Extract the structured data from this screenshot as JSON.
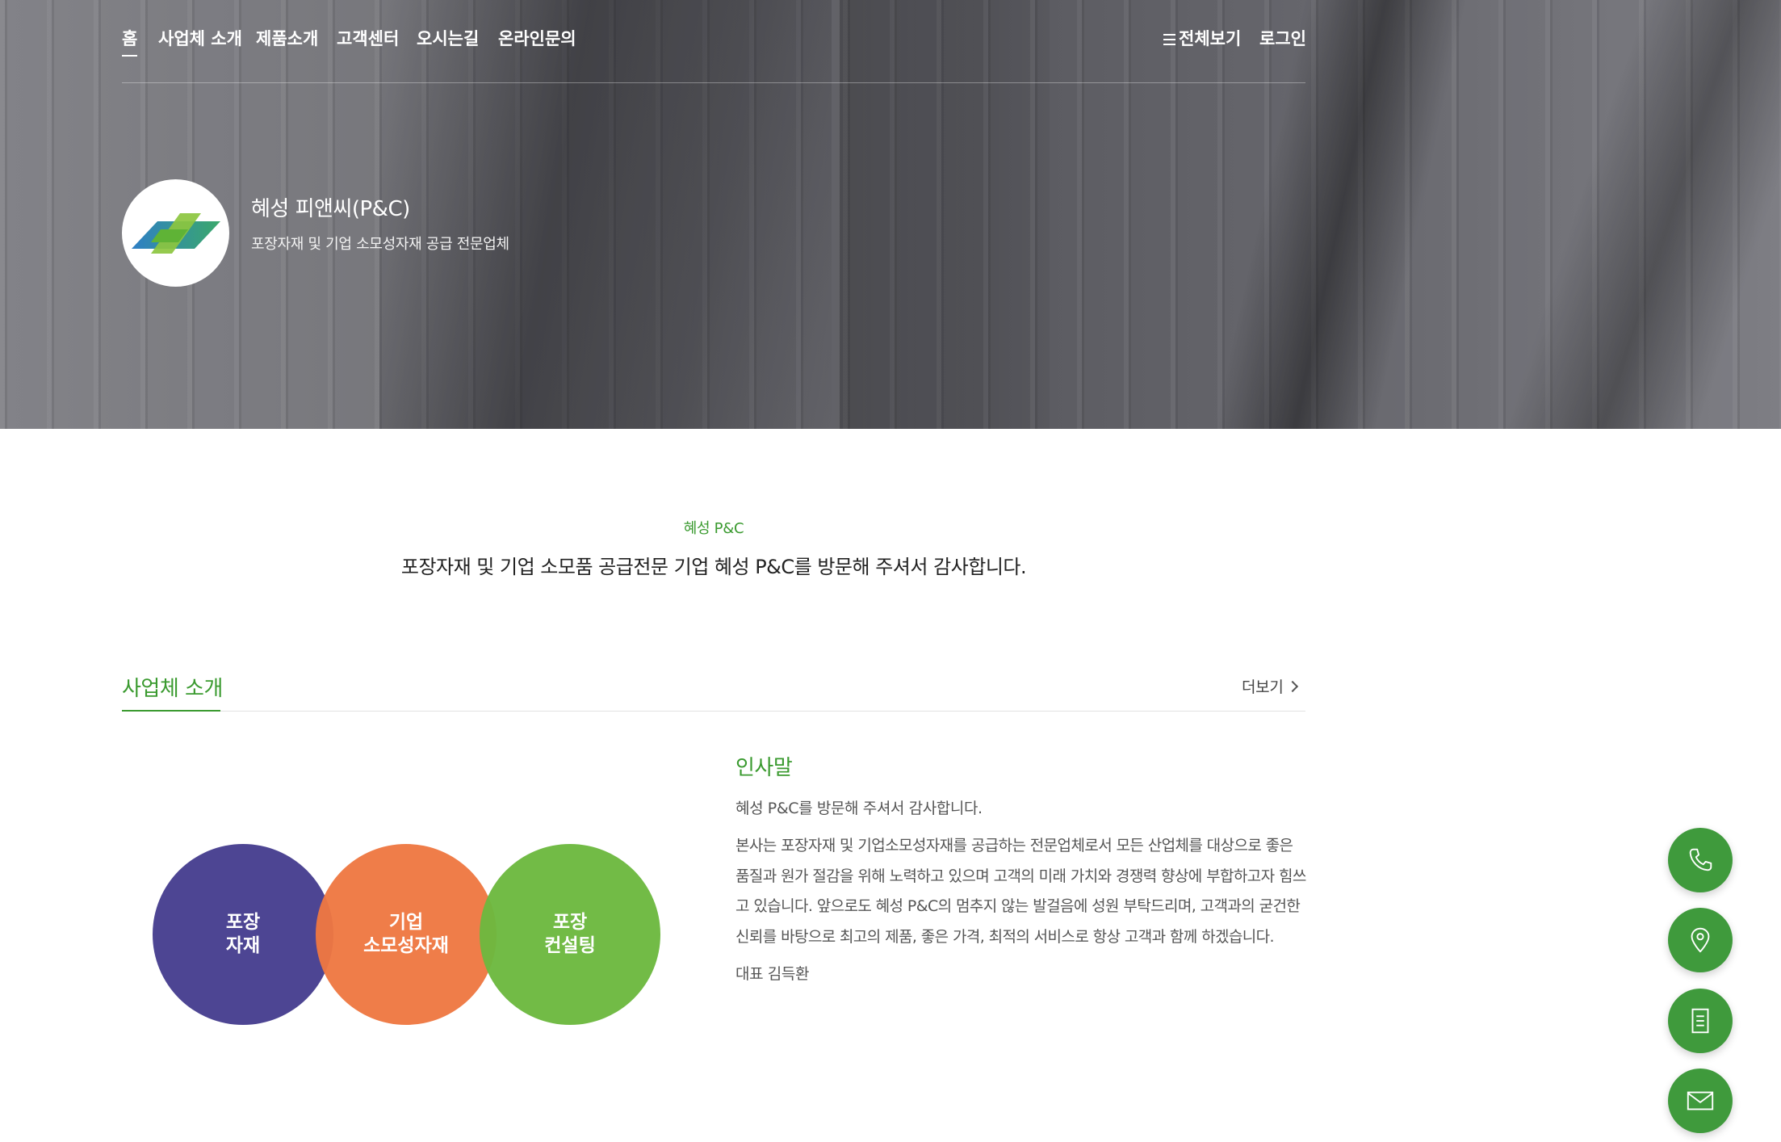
{
  "nav": {
    "items": [
      {
        "label": "홈",
        "active": true
      },
      {
        "label": "사업체 소개"
      },
      {
        "label": "제품소개"
      },
      {
        "label": "고객센터"
      },
      {
        "label": "오시는길"
      },
      {
        "label": "온라인문의"
      }
    ],
    "all_menu_label": "전체보기",
    "login_label": "로그인"
  },
  "company": {
    "name": "혜성 피앤씨(P&C)",
    "tagline": "포장자재 및 기업 소모성자재 공급 전문업체"
  },
  "welcome": {
    "label": "혜성 P&C",
    "text": "포장자재 및 기업 소모품 공급전문 기업 혜성 P&C를 방문해 주셔서 감사합니다."
  },
  "about": {
    "title": "사업체 소개",
    "more_label": "더보기",
    "venn": [
      {
        "label": "포장\n자재",
        "color": "#4d4593"
      },
      {
        "label": "기업\n소모성자재",
        "color": "#ee7842"
      },
      {
        "label": "포장\n컨설팅",
        "color": "#6cb83e"
      }
    ],
    "greeting": {
      "title": "인사말",
      "lead": "혜성 P&C를 방문해 주셔서 감사합니다.",
      "body": "본사는 포장자재 및 기업소모성자재를 공급하는 전문업체로서 모든 산업체를 대상으로 좋은 품질과 원가 절감을 위해 노력하고 있으며 고객의 미래 가치와 경쟁력 향상에 부합하고자 힘쓰고 있습니다. 앞으로도 혜성 P&C의 멈추지 않는 발걸음에 성원 부탁드리며, 고객과의 굳건한 신뢰를 바탕으로 최고의 제품, 좋은 가격, 최적의 서비스로 항상 고객과 함께 하겠습니다.",
      "signature": "대표 김득환"
    }
  },
  "fabs": [
    {
      "icon": "phone-icon"
    },
    {
      "icon": "location-pin-icon"
    },
    {
      "icon": "document-icon"
    },
    {
      "icon": "mail-icon"
    }
  ],
  "colors": {
    "brand_green": "#3a9a2f",
    "fab_green": "#3f9a3c"
  }
}
